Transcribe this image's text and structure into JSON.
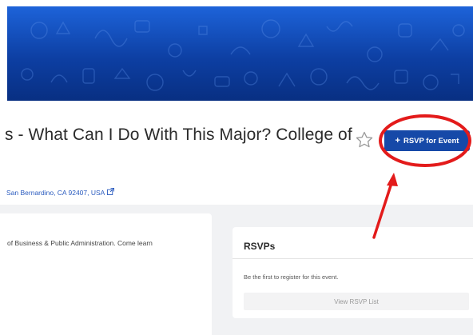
{
  "event": {
    "title": "s - What Can I Do With This Major? College of",
    "address": "San Bernardino, CA 92407, USA",
    "description_snippet": "of Business & Public Administration. Come learn"
  },
  "actions": {
    "rsvp_plus": "+",
    "rsvp_label": "RSVP for Event",
    "favorite_icon": "star-outline-icon"
  },
  "rsvps": {
    "heading": "RSVPs",
    "empty_message": "Be the first to register for this event.",
    "view_list_label": "View RSVP List"
  },
  "colors": {
    "banner_top": "#1d63d9",
    "banner_bottom": "#082f82",
    "primary_button": "#1649a8",
    "link": "#2a5bbf",
    "annotation": "#e31b1b"
  }
}
